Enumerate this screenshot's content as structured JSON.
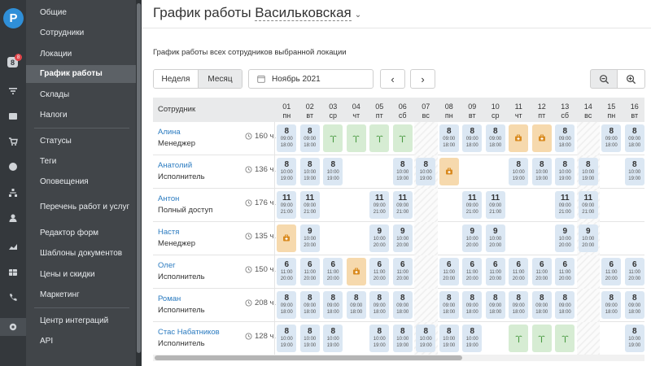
{
  "brand": {
    "logo_letter": "P",
    "notification_count": "8",
    "notification_badge": "8"
  },
  "rail_icons": [
    "filter-icon",
    "box-icon",
    "cart-icon",
    "dollar-icon",
    "sitemap-icon",
    "users-icon",
    "chart-icon",
    "table-icon",
    "phone-icon",
    "gear-icon"
  ],
  "menu": {
    "items": [
      {
        "label": "Общие"
      },
      {
        "label": "Сотрудники"
      },
      {
        "label": "Локации"
      },
      {
        "label": "График работы",
        "active": true
      },
      {
        "label": "Склады"
      },
      {
        "label": "Налоги"
      },
      {
        "label": "Статусы"
      },
      {
        "label": "Теги"
      },
      {
        "label": "Оповещения"
      },
      {
        "label": "Перечень работ и услуг"
      },
      {
        "label": "Редактор форм"
      },
      {
        "label": "Шаблоны документов"
      },
      {
        "label": "Цены и скидки"
      },
      {
        "label": "Маркетинг"
      },
      {
        "label": "Центр интеграций"
      },
      {
        "label": "API"
      }
    ]
  },
  "page": {
    "title": "График работы",
    "location": "Васильковская",
    "subtitle": "График работы всех сотрудников выбранной локации"
  },
  "toolbar": {
    "week_label": "Неделя",
    "month_label": "Месяц",
    "date_value": "Ноябрь 2021",
    "prev_label": "‹",
    "next_label": "›"
  },
  "schedule": {
    "employee_header": "Сотрудник",
    "days": [
      {
        "n": "01",
        "w": "пн"
      },
      {
        "n": "02",
        "w": "вт"
      },
      {
        "n": "03",
        "w": "ср"
      },
      {
        "n": "04",
        "w": "чт"
      },
      {
        "n": "05",
        "w": "пт"
      },
      {
        "n": "06",
        "w": "сб"
      },
      {
        "n": "07",
        "w": "вс"
      },
      {
        "n": "08",
        "w": "пн"
      },
      {
        "n": "09",
        "w": "вт"
      },
      {
        "n": "10",
        "w": "ср"
      },
      {
        "n": "11",
        "w": "чт"
      },
      {
        "n": "12",
        "w": "пт"
      },
      {
        "n": "13",
        "w": "сб"
      },
      {
        "n": "14",
        "w": "вс"
      },
      {
        "n": "15",
        "w": "пн"
      },
      {
        "n": "16",
        "w": "вт"
      }
    ],
    "weekend_columns": [
      6,
      13
    ],
    "employees": [
      {
        "name": "Алина",
        "role": "Менеджер",
        "hours": "160 ч.",
        "cells": [
          {
            "d": 0,
            "k": "s",
            "h": "8",
            "a": "09:00",
            "b": "18:00"
          },
          {
            "d": 1,
            "k": "s",
            "h": "8",
            "a": "09:00",
            "b": "18:00"
          },
          {
            "d": 2,
            "k": "v"
          },
          {
            "d": 3,
            "k": "v"
          },
          {
            "d": 4,
            "k": "v"
          },
          {
            "d": 5,
            "k": "v"
          },
          {
            "d": 7,
            "k": "s",
            "h": "8",
            "a": "09:00",
            "b": "18:00"
          },
          {
            "d": 8,
            "k": "s",
            "h": "8",
            "a": "09:00",
            "b": "18:00"
          },
          {
            "d": 9,
            "k": "s",
            "h": "8",
            "a": "09:00",
            "b": "18:00"
          },
          {
            "d": 10,
            "k": "k"
          },
          {
            "d": 11,
            "k": "k"
          },
          {
            "d": 12,
            "k": "s",
            "h": "8",
            "a": "09:00",
            "b": "18:00"
          },
          {
            "d": 14,
            "k": "s",
            "h": "8",
            "a": "09:00",
            "b": "18:00"
          },
          {
            "d": 15,
            "k": "s",
            "h": "8",
            "a": "09:00",
            "b": "18:00"
          }
        ]
      },
      {
        "name": "Анатолий",
        "role": "Исполнитель",
        "hours": "136 ч.",
        "cells": [
          {
            "d": 0,
            "k": "s",
            "h": "8",
            "a": "10:00",
            "b": "19:00"
          },
          {
            "d": 1,
            "k": "s",
            "h": "8",
            "a": "10:00",
            "b": "19:00"
          },
          {
            "d": 2,
            "k": "s",
            "h": "8",
            "a": "10:00",
            "b": "19:00"
          },
          {
            "d": 5,
            "k": "s",
            "h": "8",
            "a": "10:00",
            "b": "19:00"
          },
          {
            "d": 6,
            "k": "s",
            "h": "8",
            "a": "10:00",
            "b": "19:00"
          },
          {
            "d": 7,
            "k": "k"
          },
          {
            "d": 10,
            "k": "s",
            "h": "8",
            "a": "10:00",
            "b": "19:00"
          },
          {
            "d": 11,
            "k": "s",
            "h": "8",
            "a": "10:00",
            "b": "19:00"
          },
          {
            "d": 12,
            "k": "s",
            "h": "8",
            "a": "10:00",
            "b": "19:00"
          },
          {
            "d": 13,
            "k": "s",
            "h": "8",
            "a": "10:00",
            "b": "19:00"
          },
          {
            "d": 15,
            "k": "s",
            "h": "8",
            "a": "10:00",
            "b": "19:00"
          }
        ]
      },
      {
        "name": "Антон",
        "role": "Полный доступ",
        "hours": "176 ч.",
        "cells": [
          {
            "d": 0,
            "k": "s",
            "h": "11",
            "a": "09:00",
            "b": "21:00"
          },
          {
            "d": 1,
            "k": "s",
            "h": "11",
            "a": "09:00",
            "b": "21:00"
          },
          {
            "d": 4,
            "k": "s",
            "h": "11",
            "a": "09:00",
            "b": "21:00"
          },
          {
            "d": 5,
            "k": "s",
            "h": "11",
            "a": "09:00",
            "b": "21:00"
          },
          {
            "d": 8,
            "k": "s",
            "h": "11",
            "a": "09:00",
            "b": "21:00"
          },
          {
            "d": 9,
            "k": "s",
            "h": "11",
            "a": "09:00",
            "b": "21:00"
          },
          {
            "d": 12,
            "k": "s",
            "h": "11",
            "a": "09:00",
            "b": "21:00"
          },
          {
            "d": 13,
            "k": "s",
            "h": "11",
            "a": "09:00",
            "b": "21:00"
          }
        ]
      },
      {
        "name": "Настя",
        "role": "Менеджер",
        "hours": "135 ч.",
        "cells": [
          {
            "d": 0,
            "k": "k"
          },
          {
            "d": 1,
            "k": "s",
            "h": "9",
            "a": "10:00",
            "b": "20:00"
          },
          {
            "d": 4,
            "k": "s",
            "h": "9",
            "a": "10:00",
            "b": "20:00"
          },
          {
            "d": 5,
            "k": "s",
            "h": "9",
            "a": "10:00",
            "b": "20:00"
          },
          {
            "d": 8,
            "k": "s",
            "h": "9",
            "a": "10:00",
            "b": "20:00"
          },
          {
            "d": 9,
            "k": "s",
            "h": "9",
            "a": "10:00",
            "b": "20:00"
          },
          {
            "d": 12,
            "k": "s",
            "h": "9",
            "a": "10:00",
            "b": "20:00"
          },
          {
            "d": 13,
            "k": "s",
            "h": "9",
            "a": "10:00",
            "b": "20:00"
          }
        ]
      },
      {
        "name": "Олег",
        "role": "Исполнитель",
        "hours": "150 ч.",
        "cells": [
          {
            "d": 0,
            "k": "s",
            "h": "6",
            "a": "11:00",
            "b": "20:00"
          },
          {
            "d": 1,
            "k": "s",
            "h": "6",
            "a": "11:00",
            "b": "20:00"
          },
          {
            "d": 2,
            "k": "s",
            "h": "6",
            "a": "11:00",
            "b": "20:00"
          },
          {
            "d": 3,
            "k": "k"
          },
          {
            "d": 4,
            "k": "s",
            "h": "6",
            "a": "11:00",
            "b": "20:00"
          },
          {
            "d": 5,
            "k": "s",
            "h": "6",
            "a": "11:00",
            "b": "20:00"
          },
          {
            "d": 7,
            "k": "s",
            "h": "6",
            "a": "11:00",
            "b": "20:00"
          },
          {
            "d": 8,
            "k": "s",
            "h": "6",
            "a": "11:00",
            "b": "20:00"
          },
          {
            "d": 9,
            "k": "s",
            "h": "6",
            "a": "11:00",
            "b": "20:00"
          },
          {
            "d": 10,
            "k": "s",
            "h": "6",
            "a": "11:00",
            "b": "20:00"
          },
          {
            "d": 11,
            "k": "s",
            "h": "6",
            "a": "11:00",
            "b": "20:00"
          },
          {
            "d": 12,
            "k": "s",
            "h": "6",
            "a": "11:00",
            "b": "20:00"
          },
          {
            "d": 14,
            "k": "s",
            "h": "6",
            "a": "11:00",
            "b": "20:00"
          },
          {
            "d": 15,
            "k": "s",
            "h": "6",
            "a": "11:00",
            "b": "20:00"
          }
        ]
      },
      {
        "name": "Роман",
        "role": "Исполнитель",
        "hours": "208 ч.",
        "cells": [
          {
            "d": 0,
            "k": "s",
            "h": "8",
            "a": "09:00",
            "b": "18:00"
          },
          {
            "d": 1,
            "k": "s",
            "h": "8",
            "a": "09:00",
            "b": "18:00"
          },
          {
            "d": 2,
            "k": "s",
            "h": "8",
            "a": "09:00",
            "b": "18:00"
          },
          {
            "d": 3,
            "k": "s",
            "h": "8",
            "a": "09:00",
            "b": "18:00"
          },
          {
            "d": 4,
            "k": "s",
            "h": "8",
            "a": "09:00",
            "b": "18:00"
          },
          {
            "d": 5,
            "k": "s",
            "h": "8",
            "a": "09:00",
            "b": "18:00"
          },
          {
            "d": 7,
            "k": "s",
            "h": "8",
            "a": "09:00",
            "b": "18:00"
          },
          {
            "d": 8,
            "k": "s",
            "h": "8",
            "a": "09:00",
            "b": "18:00"
          },
          {
            "d": 9,
            "k": "s",
            "h": "8",
            "a": "09:00",
            "b": "18:00"
          },
          {
            "d": 10,
            "k": "s",
            "h": "8",
            "a": "09:00",
            "b": "18:00"
          },
          {
            "d": 11,
            "k": "s",
            "h": "8",
            "a": "09:00",
            "b": "18:00"
          },
          {
            "d": 12,
            "k": "s",
            "h": "8",
            "a": "09:00",
            "b": "18:00"
          },
          {
            "d": 14,
            "k": "s",
            "h": "8",
            "a": "09:00",
            "b": "18:00"
          },
          {
            "d": 15,
            "k": "s",
            "h": "8",
            "a": "09:00",
            "b": "18:00"
          }
        ]
      },
      {
        "name": "Стас Набатников",
        "role": "Исполнитель",
        "hours": "128 ч.",
        "cells": [
          {
            "d": 0,
            "k": "s",
            "h": "8",
            "a": "10:00",
            "b": "19:00"
          },
          {
            "d": 1,
            "k": "s",
            "h": "8",
            "a": "10:00",
            "b": "19:00"
          },
          {
            "d": 2,
            "k": "s",
            "h": "8",
            "a": "10:00",
            "b": "19:00"
          },
          {
            "d": 4,
            "k": "s",
            "h": "8",
            "a": "10:00",
            "b": "19:00"
          },
          {
            "d": 5,
            "k": "s",
            "h": "8",
            "a": "10:00",
            "b": "19:00"
          },
          {
            "d": 6,
            "k": "s",
            "h": "8",
            "a": "10:00",
            "b": "19:00"
          },
          {
            "d": 7,
            "k": "s",
            "h": "8",
            "a": "10:00",
            "b": "19:00"
          },
          {
            "d": 8,
            "k": "s",
            "h": "8",
            "a": "10:00",
            "b": "19:00"
          },
          {
            "d": 10,
            "k": "v"
          },
          {
            "d": 11,
            "k": "v"
          },
          {
            "d": 12,
            "k": "v"
          },
          {
            "d": 15,
            "k": "s",
            "h": "8",
            "a": "10:00",
            "b": "19:00"
          }
        ]
      }
    ]
  },
  "colors": {
    "accent": "#2b7bc0",
    "shift": "#dbe7f3",
    "vacation": "#d6ecd3",
    "sick": "#f6d9ad",
    "sidebar": "#414549"
  }
}
